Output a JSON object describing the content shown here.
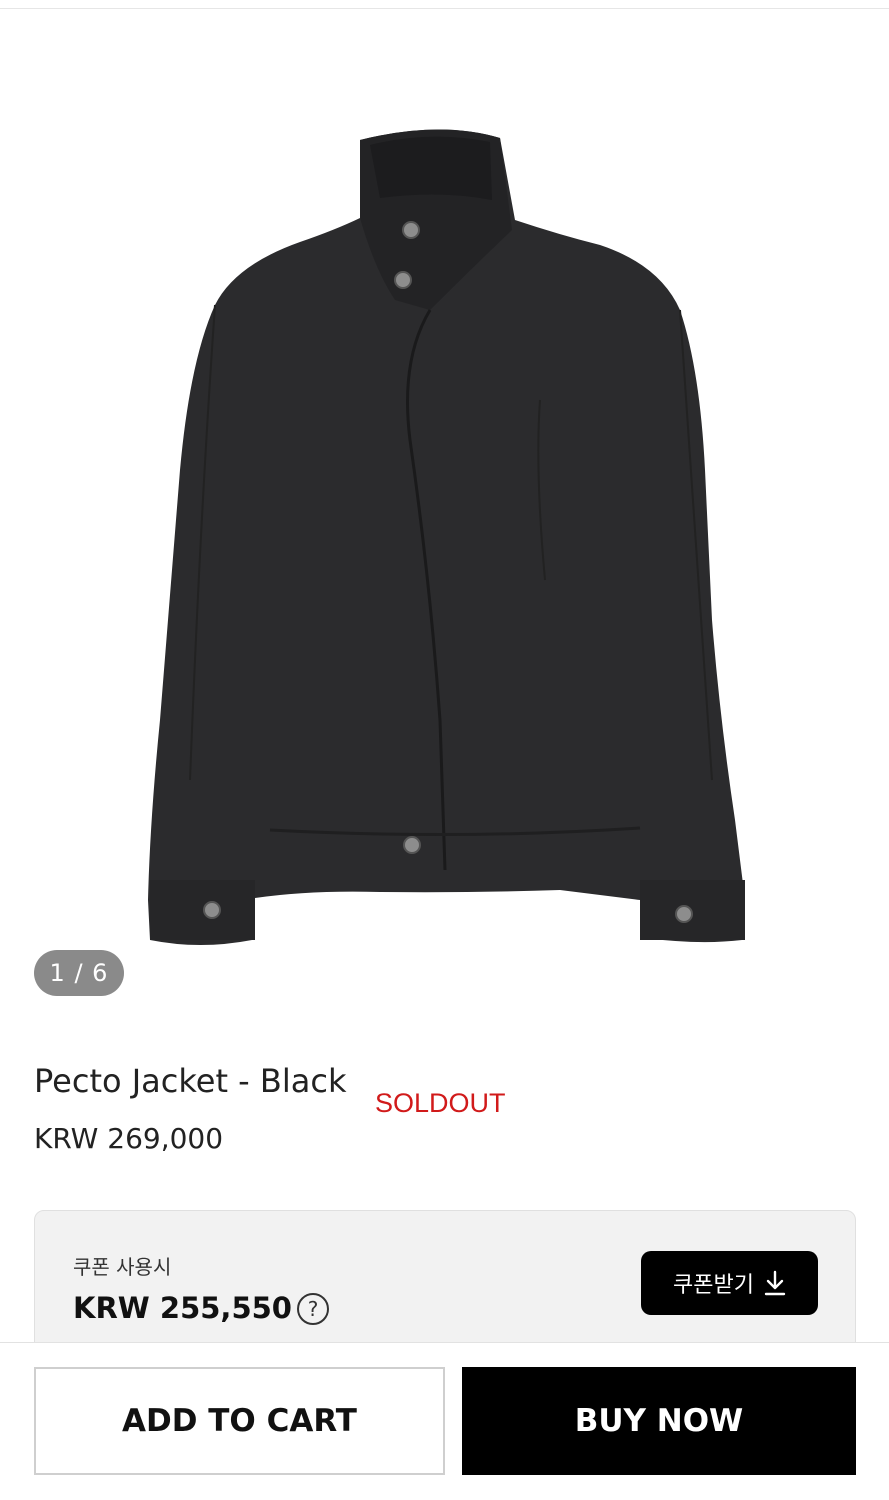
{
  "gallery": {
    "counter": "1 / 6",
    "image_description_icon": "jacket-photo"
  },
  "product": {
    "title": "Pecto Jacket - Black",
    "status": "SOLDOUT",
    "price": "KRW 269,000"
  },
  "coupon": {
    "label": "쿠폰 사용시",
    "price": "KRW 255,550",
    "help_icon": "?",
    "button_label": "쿠폰받기"
  },
  "actions": {
    "add_to_cart": "ADD TO CART",
    "buy_now": "BUY NOW"
  },
  "colors": {
    "soldout": "#d11a1a",
    "primary": "#000000",
    "counter_bg": "#8a8a8a",
    "coupon_bg": "#f2f2f2"
  }
}
